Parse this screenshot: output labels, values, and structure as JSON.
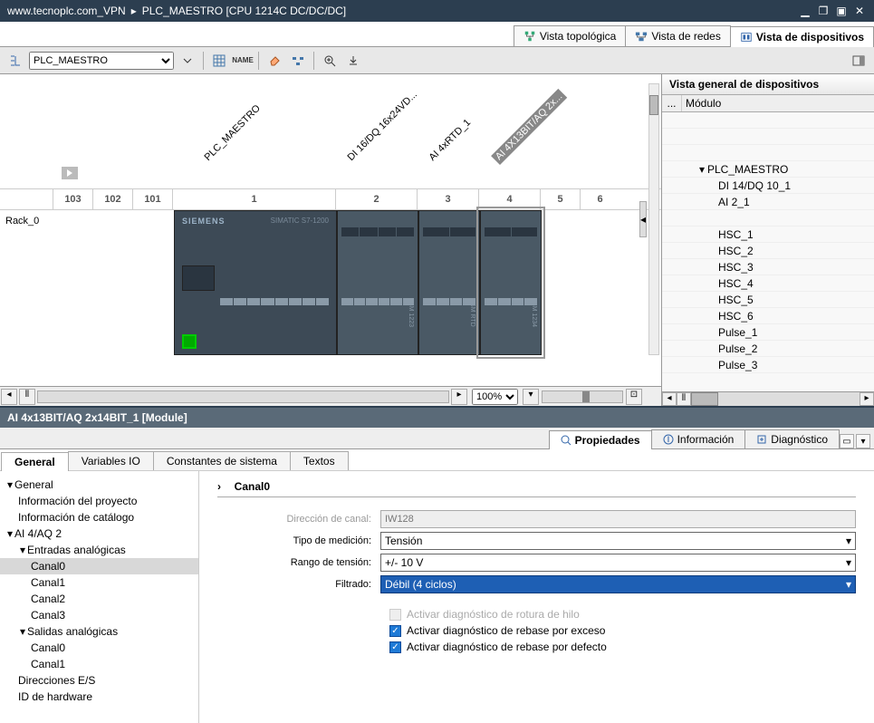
{
  "titlebar": {
    "path1": "www.tecnoplc.com_VPN",
    "path2": "PLC_MAESTRO [CPU 1214C DC/DC/DC]"
  },
  "viewtabs": {
    "topology": "Vista topológica",
    "network": "Vista de redes",
    "device": "Vista de dispositivos"
  },
  "toolbar": {
    "device_select": "PLC_MAESTRO"
  },
  "canvas": {
    "rack_label": "Rack_0",
    "slot_headers": [
      "103",
      "102",
      "101",
      "1",
      "2",
      "3",
      "4",
      "5",
      "6"
    ],
    "module_labels": {
      "cpu": "PLC_MAESTRO",
      "m2": "DI 16/DQ 16x24VD...",
      "m3": "AI 4xRTD_1",
      "m4": "AI 4X13BIT/AQ 2x..."
    },
    "cpu_brand": "SIEMENS",
    "cpu_model": "SIMATIC S7-1200"
  },
  "zoom": {
    "value": "100%"
  },
  "overview": {
    "title": "Vista general de dispositivos",
    "col1": "...",
    "col2": "Módulo",
    "rows": [
      {
        "txt": "PLC_MAESTRO",
        "lvl": 1,
        "exp": true
      },
      {
        "txt": "DI 14/DQ 10_1",
        "lvl": 2
      },
      {
        "txt": "AI 2_1",
        "lvl": 2
      },
      {
        "txt": "",
        "lvl": 2
      },
      {
        "txt": "HSC_1",
        "lvl": 2
      },
      {
        "txt": "HSC_2",
        "lvl": 2
      },
      {
        "txt": "HSC_3",
        "lvl": 2
      },
      {
        "txt": "HSC_4",
        "lvl": 2
      },
      {
        "txt": "HSC_5",
        "lvl": 2
      },
      {
        "txt": "HSC_6",
        "lvl": 2
      },
      {
        "txt": "Pulse_1",
        "lvl": 2
      },
      {
        "txt": "Pulse_2",
        "lvl": 2
      },
      {
        "txt": "Pulse_3",
        "lvl": 2
      }
    ]
  },
  "inspector": {
    "title": "AI 4x13BIT/AQ 2x14BIT_1 [Module]",
    "tabs": {
      "properties": "Propiedades",
      "info": "Información",
      "diag": "Diagnóstico"
    },
    "subtabs": {
      "general": "General",
      "vars": "Variables IO",
      "consts": "Constantes de sistema",
      "texts": "Textos"
    },
    "tree": [
      {
        "txt": "General",
        "lvl": 0,
        "exp": "▾"
      },
      {
        "txt": "Información del proyecto",
        "lvl": 1
      },
      {
        "txt": "Información de catálogo",
        "lvl": 1
      },
      {
        "txt": "AI 4/AQ 2",
        "lvl": 0,
        "exp": "▾"
      },
      {
        "txt": "Entradas analógicas",
        "lvl": 1,
        "exp": "▾"
      },
      {
        "txt": "Canal0",
        "lvl": 2,
        "sel": true
      },
      {
        "txt": "Canal1",
        "lvl": 2
      },
      {
        "txt": "Canal2",
        "lvl": 2
      },
      {
        "txt": "Canal3",
        "lvl": 2
      },
      {
        "txt": "Salidas analógicas",
        "lvl": 1,
        "exp": "▾"
      },
      {
        "txt": "Canal0",
        "lvl": 2
      },
      {
        "txt": "Canal1",
        "lvl": 2
      },
      {
        "txt": "Direcciones E/S",
        "lvl": 1
      },
      {
        "txt": "ID de hardware",
        "lvl": 1
      }
    ],
    "props": {
      "heading": "Canal0",
      "addr_lbl": "Dirección de canal:",
      "addr_val": "IW128",
      "type_lbl": "Tipo de medición:",
      "type_val": "Tensión",
      "range_lbl": "Rango de tensión:",
      "range_val": "+/- 10 V",
      "filter_lbl": "Filtrado:",
      "filter_val": "Débil (4 ciclos)",
      "chk1": "Activar diagnóstico de rotura de hilo",
      "chk2": "Activar diagnóstico de rebase por exceso",
      "chk3": "Activar diagnóstico de rebase por defecto"
    }
  }
}
